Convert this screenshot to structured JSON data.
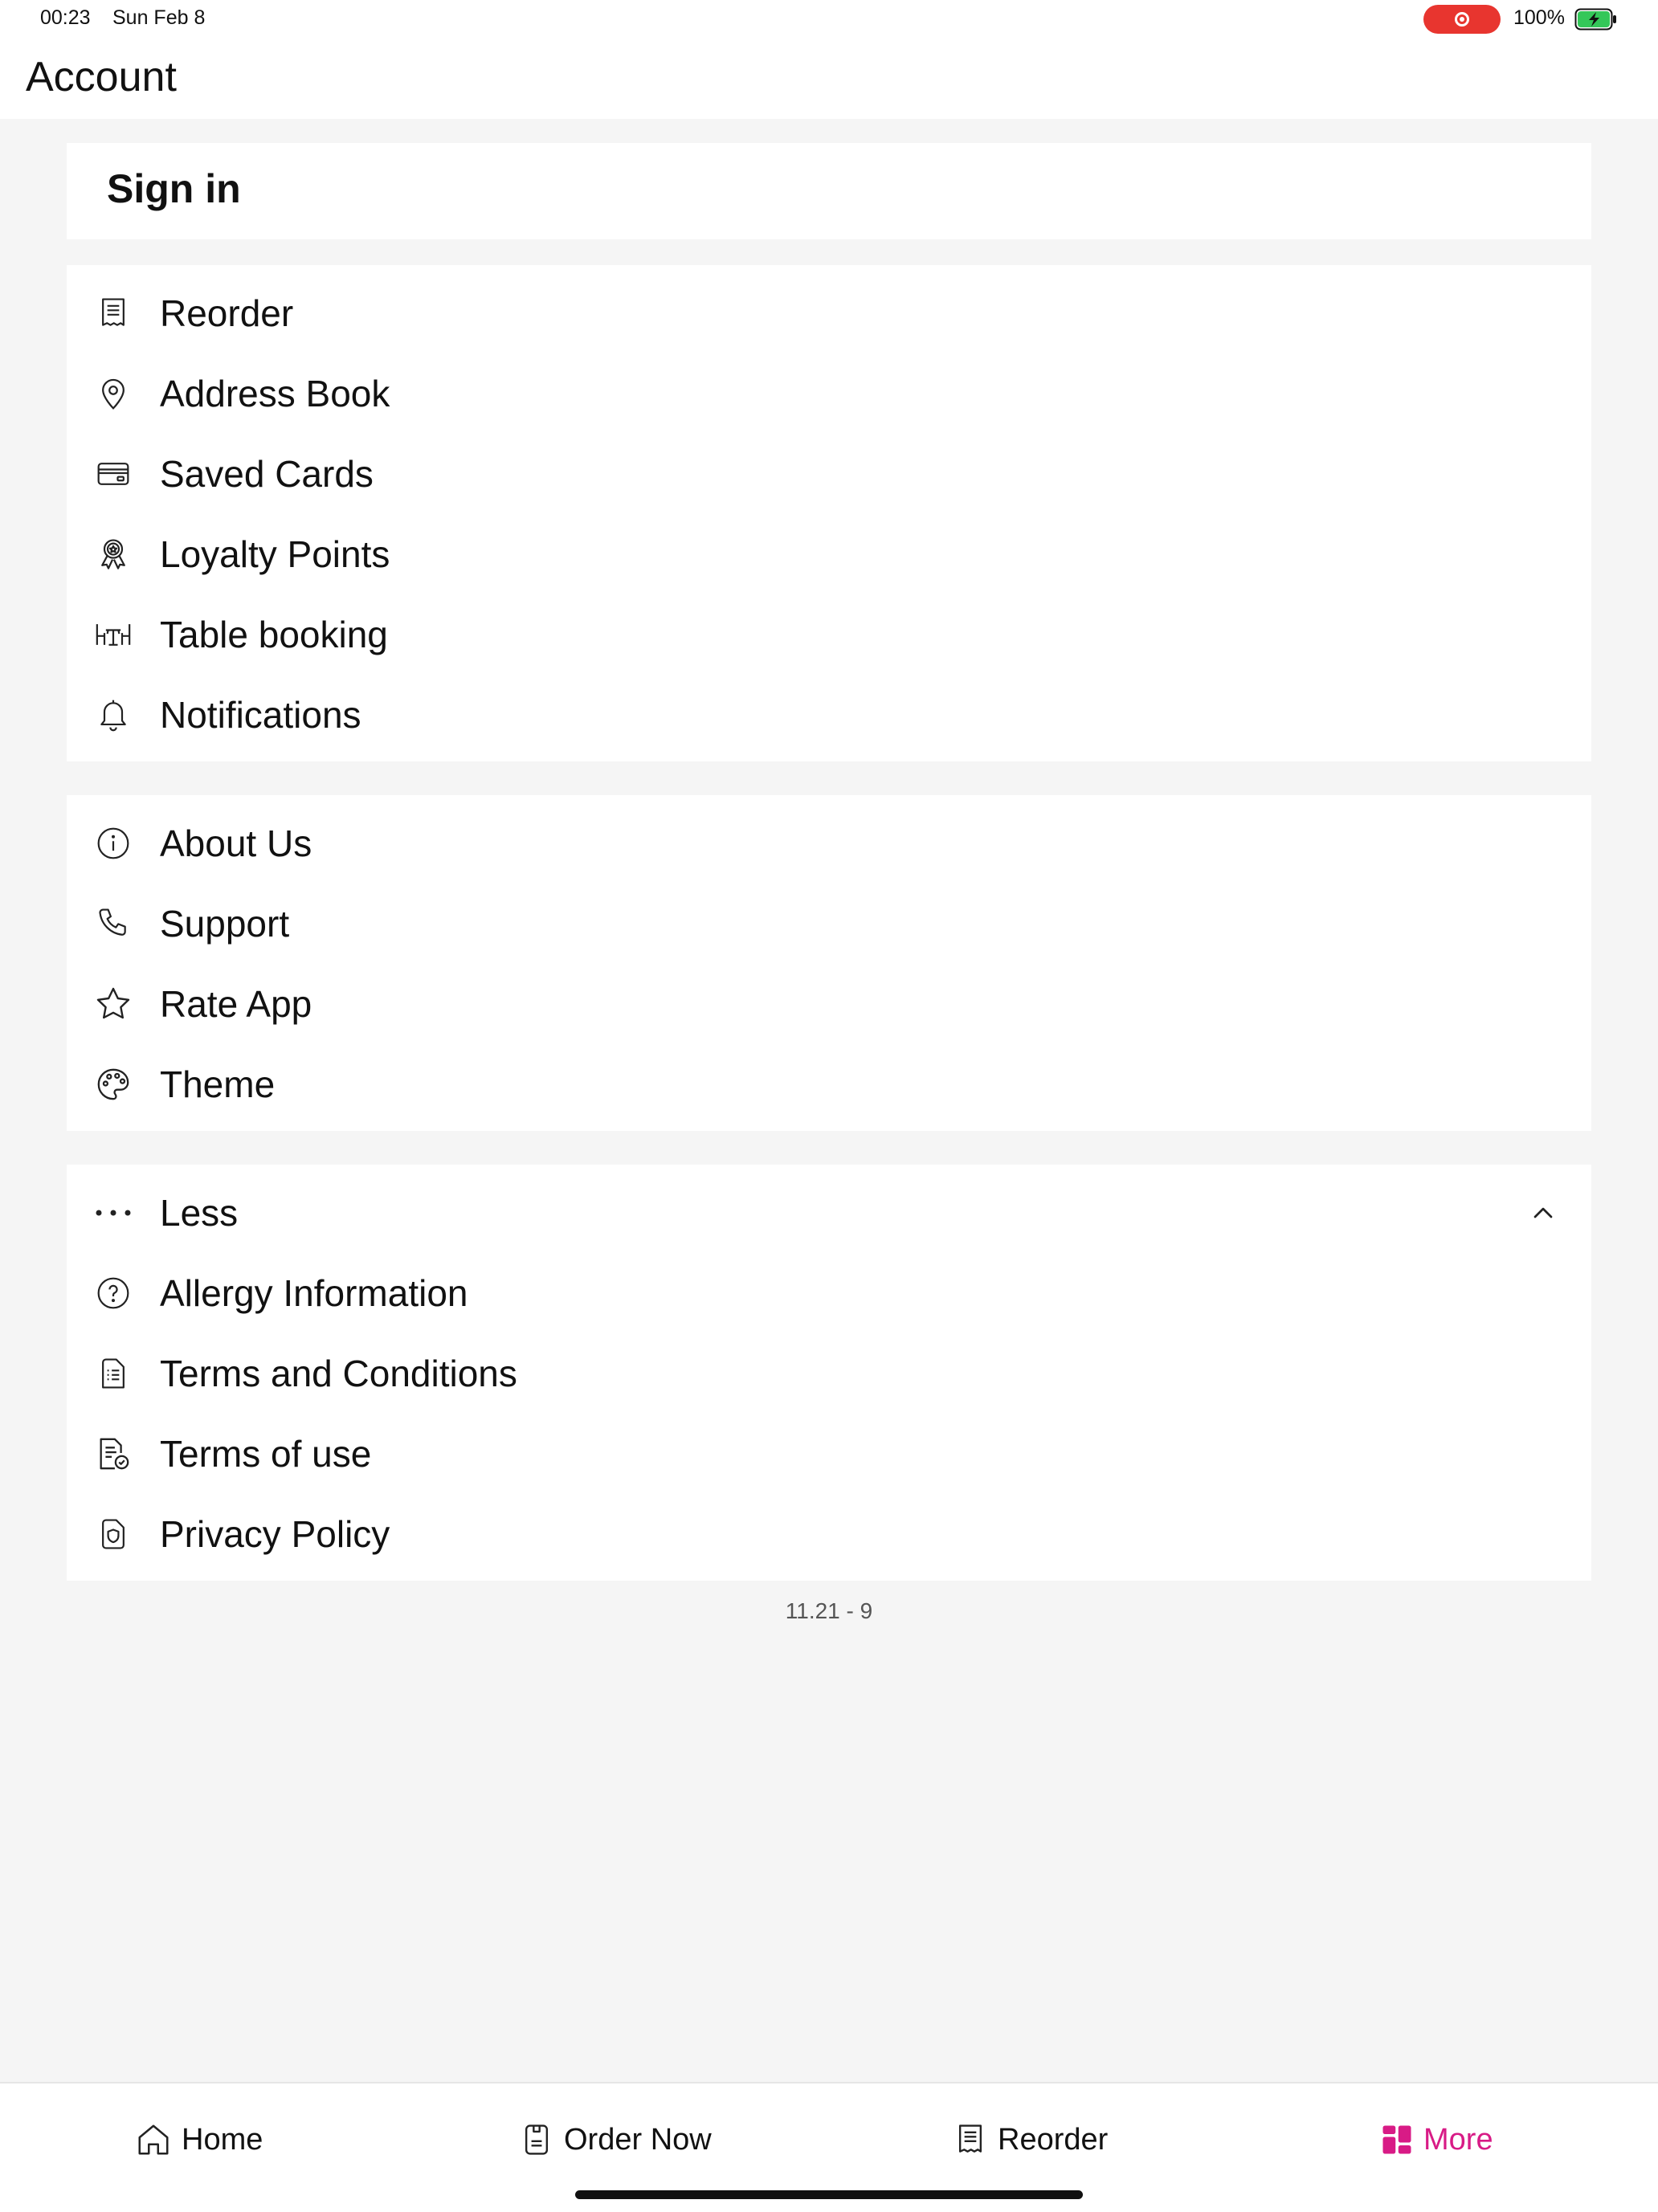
{
  "status_bar": {
    "time": "00:23",
    "date": "Sun Feb 8",
    "battery": "100%"
  },
  "header": {
    "title": "Account"
  },
  "sign_in": {
    "label": "Sign in"
  },
  "account_items": [
    {
      "label": "Reorder",
      "icon": "receipt-icon"
    },
    {
      "label": "Address Book",
      "icon": "location-pin-icon"
    },
    {
      "label": "Saved Cards",
      "icon": "credit-card-icon"
    },
    {
      "label": "Loyalty Points",
      "icon": "award-badge-icon"
    },
    {
      "label": "Table booking",
      "icon": "table-chairs-icon"
    },
    {
      "label": "Notifications",
      "icon": "bell-icon"
    }
  ],
  "info_items": [
    {
      "label": "About Us",
      "icon": "info-icon"
    },
    {
      "label": "Support",
      "icon": "phone-icon"
    },
    {
      "label": "Rate App",
      "icon": "star-icon"
    },
    {
      "label": "Theme",
      "icon": "palette-icon"
    }
  ],
  "more_section": {
    "toggle_label": "Less",
    "toggle_icon": "more-dots-icon",
    "items": [
      {
        "label": "Allergy Information",
        "icon": "question-circle-icon"
      },
      {
        "label": "Terms and Conditions",
        "icon": "document-list-icon"
      },
      {
        "label": "Terms of use",
        "icon": "document-check-icon"
      },
      {
        "label": "Privacy Policy",
        "icon": "shield-document-icon"
      }
    ]
  },
  "version": "11.21 - 9",
  "bottom_nav": [
    {
      "label": "Home",
      "icon": "home-icon",
      "active": false
    },
    {
      "label": "Order Now",
      "icon": "order-icon",
      "active": false
    },
    {
      "label": "Reorder",
      "icon": "receipt-icon",
      "active": false
    },
    {
      "label": "More",
      "icon": "grid-icon",
      "active": true
    }
  ],
  "colors": {
    "accent": "#d81b86",
    "background": "#f5f5f5",
    "recording": "#e8352f",
    "battery": "#34c759"
  }
}
